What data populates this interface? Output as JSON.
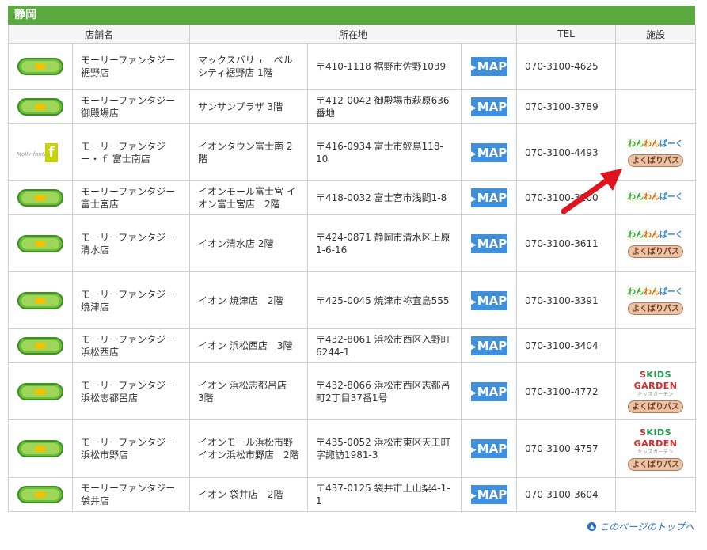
{
  "region": "静岡",
  "headers": {
    "name": "店舗名",
    "address": "所在地",
    "tel": "TEL",
    "facility": "施設"
  },
  "map_label": "MAP",
  "badges": {
    "wan": "わんわんぱーく",
    "yoku": "よくばりパス",
    "kids": "SKIDS GARDEN",
    "kids_sub": "キッズガーデン"
  },
  "stores": [
    {
      "logo": "molly",
      "name": "モーリーファンタジー 裾野店",
      "place": "マックスバリュ　ベルシティ裾野店 1階",
      "address": "〒410-1118 裾野市佐野1039",
      "tel": "070-3100-4625",
      "facilities": []
    },
    {
      "logo": "molly",
      "name": "モーリーファンタジー 御殿場店",
      "place": "サンサンプラザ 3階",
      "address": "〒412-0042 御殿場市萩原636番地",
      "tel": "070-3100-3789",
      "facilities": []
    },
    {
      "logo": "f",
      "name": "モーリーファンタジー・ｆ 富士南店",
      "place": "イオンタウン富士南 2階",
      "address": "〒416-0934 富士市鮫島118-10",
      "tel": "070-3100-4493",
      "facilities": [
        "wan",
        "yoku"
      ]
    },
    {
      "logo": "molly",
      "name": "モーリーファンタジー 富士宮店",
      "place": "イオンモール富士宮 イオン富士宮店　2階",
      "address": "〒418-0032 富士宮市浅間1-8",
      "tel": "070-3100-3200",
      "facilities": [
        "wan"
      ]
    },
    {
      "logo": "molly",
      "name": "モーリーファンタジー 清水店",
      "place": "イオン清水店 2階",
      "address": "〒424-0871 静岡市清水区上原1-6-16",
      "tel": "070-3100-3611",
      "facilities": [
        "wan",
        "yoku"
      ]
    },
    {
      "logo": "molly",
      "name": "モーリーファンタジー 焼津店",
      "place": "イオン 焼津店　2階",
      "address": "〒425-0045 焼津市祢宜島555",
      "tel": "070-3100-3391",
      "facilities": [
        "wan",
        "yoku"
      ]
    },
    {
      "logo": "molly",
      "name": "モーリーファンタジー 浜松西店",
      "place": "イオン 浜松西店　3階",
      "address": "〒432-8061 浜松市西区入野町6244-1",
      "tel": "070-3100-3404",
      "facilities": []
    },
    {
      "logo": "molly",
      "name": "モーリーファンタジー 浜松志都呂店",
      "place": "イオン 浜松志都呂店　3階",
      "address": "〒432-8066 浜松市西区志都呂町2丁目37番1号",
      "tel": "070-3100-4772",
      "facilities": [
        "kids",
        "yoku"
      ]
    },
    {
      "logo": "molly",
      "name": "モーリーファンタジー 浜松市野店",
      "place": "イオンモール浜松市野 イオン浜松市野店　2階",
      "address": "〒435-0052 浜松市東区天王町字諏訪1981-3",
      "tel": "070-3100-4757",
      "facilities": [
        "kids",
        "yoku"
      ]
    },
    {
      "logo": "molly",
      "name": "モーリーファンタジー 袋井店",
      "place": "イオン 袋井店　2階",
      "address": "〒437-0125 袋井市上山梨4-1-1",
      "tel": "070-3100-3604",
      "facilities": []
    }
  ],
  "page_top_link": "このページのトップへ"
}
